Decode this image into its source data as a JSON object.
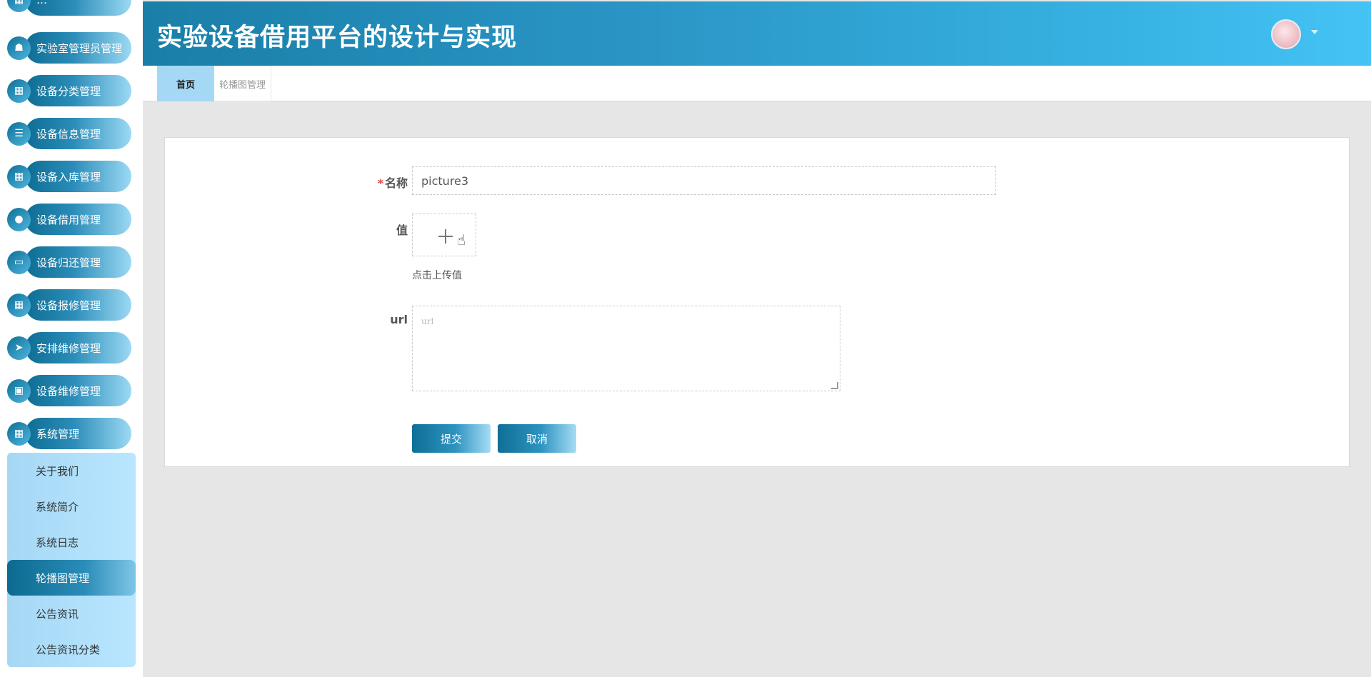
{
  "app": {
    "title": "实验设备借用平台的设计与实现"
  },
  "sidebar": {
    "items": [
      {
        "label": "…",
        "icon": "grid-icon"
      },
      {
        "label": "实验室管理员管理",
        "icon": "user-icon"
      },
      {
        "label": "设备分类管理",
        "icon": "grid-icon"
      },
      {
        "label": "设备信息管理",
        "icon": "list-icon"
      },
      {
        "label": "设备入库管理",
        "icon": "grid-icon"
      },
      {
        "label": "设备借用管理",
        "icon": "bulb-icon"
      },
      {
        "label": "设备归还管理",
        "icon": "monitor-icon"
      },
      {
        "label": "设备报修管理",
        "icon": "grid-icon"
      },
      {
        "label": "安排维修管理",
        "icon": "send-icon"
      },
      {
        "label": "设备维修管理",
        "icon": "clipboard-icon"
      },
      {
        "label": "系统管理",
        "icon": "grid-icon"
      }
    ],
    "submenu": [
      {
        "label": "关于我们"
      },
      {
        "label": "系统简介"
      },
      {
        "label": "系统日志"
      },
      {
        "label": "轮播图管理",
        "active": true
      },
      {
        "label": "公告资讯"
      },
      {
        "label": "公告资讯分类"
      }
    ]
  },
  "tabs": [
    {
      "label": "首页",
      "active": true
    },
    {
      "label": "轮播图管理",
      "active": false
    }
  ],
  "form": {
    "name_label": "名称",
    "name_required_mark": "*",
    "name_value": "picture3",
    "value_label": "值",
    "upload_hint": "点击上传值",
    "url_label": "url",
    "url_placeholder": "url",
    "submit_label": "提交",
    "cancel_label": "取消"
  },
  "colors": {
    "accent_dark": "#0e6d93",
    "accent_light": "#45c3f5",
    "submenu_bg": "#a5d8f5",
    "required": "#e04b4b"
  }
}
